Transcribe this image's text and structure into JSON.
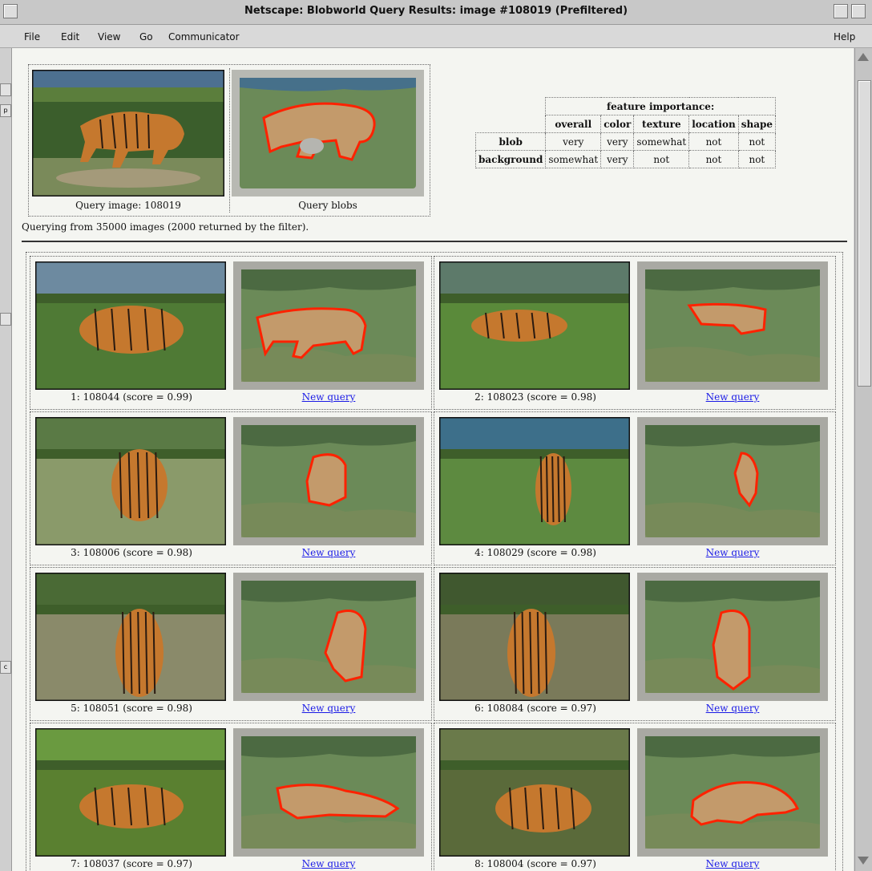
{
  "window": {
    "title": "Netscape: Blobworld Query Results: image #108019 (Prefiltered)"
  },
  "menu": {
    "items": [
      "File",
      "Edit",
      "View",
      "Go",
      "Communicator"
    ],
    "help": "Help"
  },
  "query": {
    "image_caption": "Query image: 108019",
    "blobs_caption": "Query blobs",
    "info": "Querying from 35000 images (2000 returned by the filter)."
  },
  "feature_table": {
    "heading": "feature importance:",
    "columns": [
      "overall",
      "color",
      "texture",
      "location",
      "shape"
    ],
    "rows": [
      {
        "label": "blob",
        "values": [
          "very",
          "very",
          "somewhat",
          "not",
          "not"
        ]
      },
      {
        "label": "background",
        "values": [
          "somewhat",
          "very",
          "not",
          "not",
          "not"
        ]
      }
    ]
  },
  "results": [
    {
      "caption": "1: 108044 (score = 0.99)",
      "link": "New query"
    },
    {
      "caption": "2: 108023 (score = 0.98)",
      "link": "New query"
    },
    {
      "caption": "3: 108006 (score = 0.98)",
      "link": "New query"
    },
    {
      "caption": "4: 108029 (score = 0.98)",
      "link": "New query"
    },
    {
      "caption": "5: 108051 (score = 0.98)",
      "link": "New query"
    },
    {
      "caption": "6: 108084 (score = 0.97)",
      "link": "New query"
    },
    {
      "caption": "7: 108037 (score = 0.97)",
      "link": "New query"
    },
    {
      "caption": "8: 108004 (score = 0.97)",
      "link": "New query"
    }
  ],
  "colors": {
    "blob_outline": "#ff2200",
    "blob_fill": "#c39a6b",
    "segment_green": "#6b8a58",
    "segment_dark": "#4c6a42",
    "segment_light": "#a9a9a3",
    "link": "#1a1ae6"
  },
  "icons": [
    "window-menu-icon",
    "minimize-icon",
    "maximize-icon",
    "scroll-up-icon",
    "scroll-down-icon"
  ]
}
